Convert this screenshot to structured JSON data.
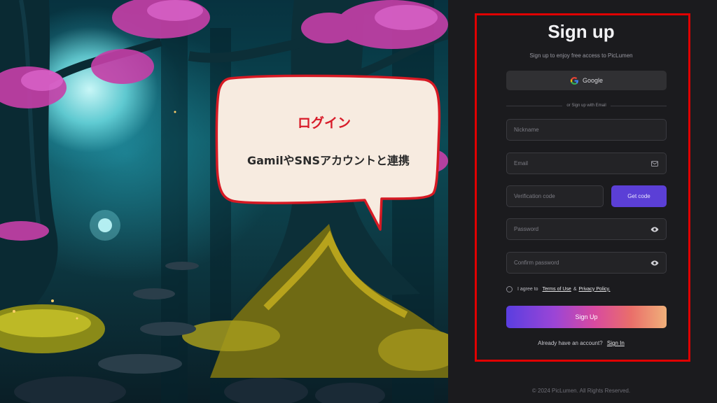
{
  "bubble": {
    "title": "ログイン",
    "subtitle": "GamilやSNSアカウントと連携"
  },
  "form": {
    "title": "Sign up",
    "subtitle": "Sign up to enjoy free access to PicLumen",
    "google_label": "Google",
    "divider_text": "or Sign up with Email",
    "nickname_placeholder": "Nickname",
    "email_placeholder": "Email",
    "code_placeholder": "Verification code",
    "get_code_label": "Get code",
    "password_placeholder": "Password",
    "confirm_placeholder": "Confirm password",
    "agree_prefix": "I agree to",
    "terms_label": "Terms of Use",
    "agree_and": "&",
    "privacy_label": "Privacy Policy.",
    "signup_label": "Sign Up",
    "already_text": "Already have an account?",
    "signin_label": "Sign In"
  },
  "footer": {
    "copyright": "© 2024 PicLumen. All Rights Reserved."
  },
  "colors": {
    "highlight": "#e00000",
    "accent": "#5b3fd6",
    "bubble_title": "#d81c2a"
  },
  "icons": [
    "google-icon",
    "email-icon",
    "eye-icon"
  ]
}
